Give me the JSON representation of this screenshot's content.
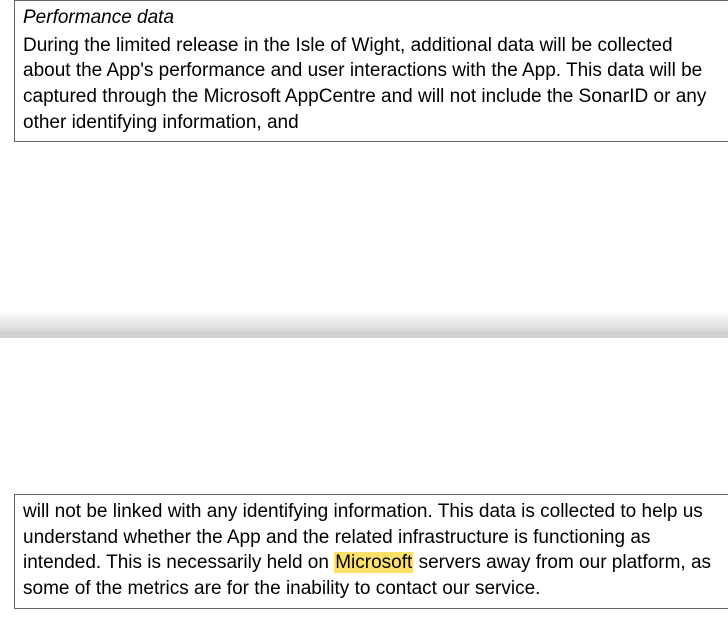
{
  "section1": {
    "heading": "Performance data",
    "paragraph": "During the limited release in the Isle of Wight, additional data will be collected about the App's performance and user interactions with the App. This data will be captured through the Microsoft AppCentre and will not include the SonarID or any other identifying information, and"
  },
  "section2": {
    "part1": "will not be linked with any identifying information. This data is collected to help us understand whether the App and the related infrastructure is functioning as intended.  This is necessarily held on ",
    "highlighted": "Microsoft",
    "part2": " servers away from our platform, as some of the metrics are for the inability to contact our service."
  }
}
